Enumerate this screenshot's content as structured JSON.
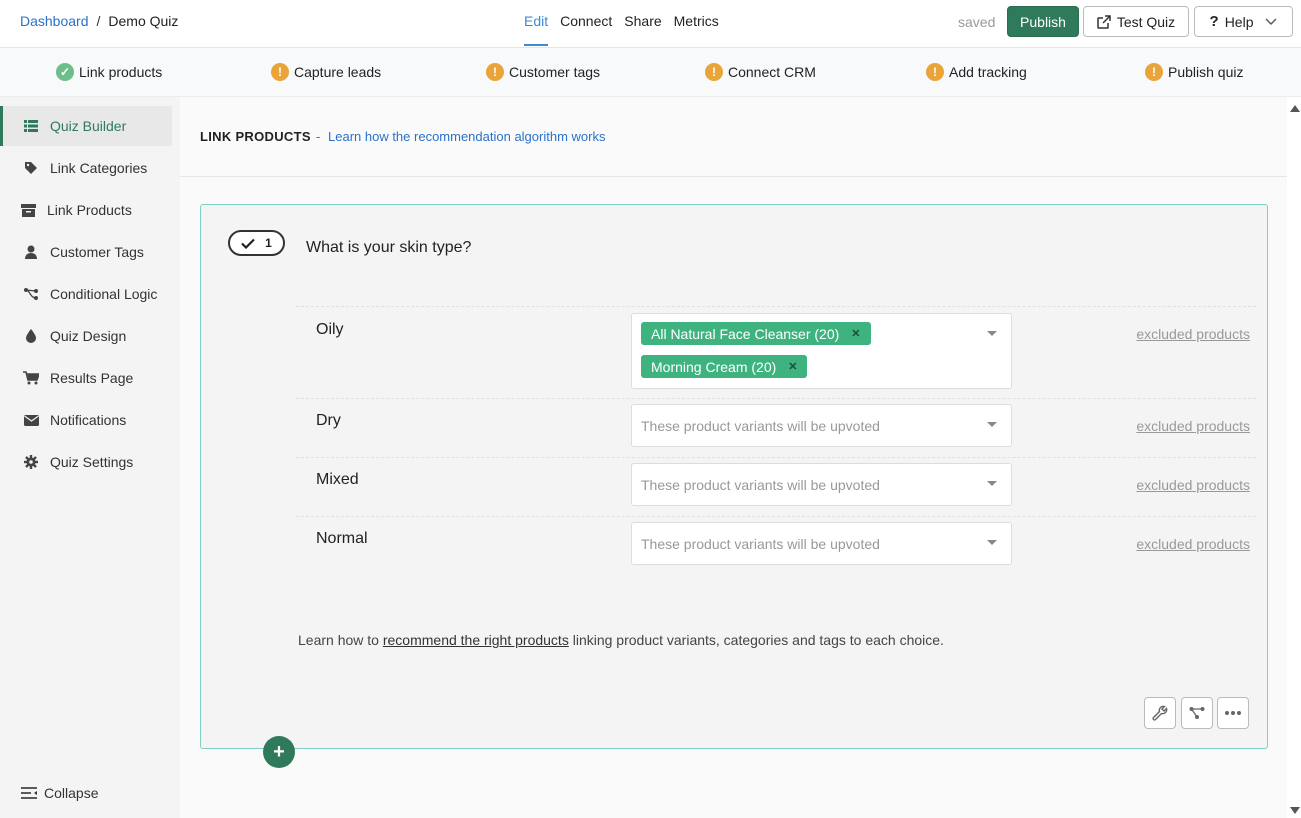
{
  "breadcrumb": {
    "dashboard": "Dashboard",
    "separator": "/",
    "current": "Demo Quiz"
  },
  "nav": {
    "tabs": [
      "Edit",
      "Connect",
      "Share",
      "Metrics"
    ],
    "active": "Edit"
  },
  "header": {
    "saved_status": "saved",
    "publish": "Publish",
    "test_quiz": "Test Quiz",
    "help": "Help"
  },
  "checklist": [
    {
      "label": "Link products",
      "status": "done",
      "icon": "check-circle-icon"
    },
    {
      "label": "Capture leads",
      "status": "warning",
      "icon": "warning-circle-icon"
    },
    {
      "label": "Customer tags",
      "status": "warning",
      "icon": "warning-circle-icon"
    },
    {
      "label": "Connect CRM",
      "status": "warning",
      "icon": "warning-circle-icon"
    },
    {
      "label": "Add tracking",
      "status": "warning",
      "icon": "warning-circle-icon"
    },
    {
      "label": "Publish quiz",
      "status": "warning",
      "icon": "warning-circle-icon"
    }
  ],
  "sidebar": {
    "items": [
      {
        "label": "Quiz Builder",
        "icon": "list-icon",
        "active": true
      },
      {
        "label": "Link Categories",
        "icon": "tag-icon"
      },
      {
        "label": "Link Products",
        "icon": "box-icon"
      },
      {
        "label": "Customer Tags",
        "icon": "user-icon"
      },
      {
        "label": "Conditional Logic",
        "icon": "branch-icon"
      },
      {
        "label": "Quiz Design",
        "icon": "drop-icon"
      },
      {
        "label": "Results Page",
        "icon": "cart-icon"
      },
      {
        "label": "Notifications",
        "icon": "envelope-icon"
      },
      {
        "label": "Quiz Settings",
        "icon": "gear-icon"
      }
    ],
    "collapse": "Collapse"
  },
  "main": {
    "section_title": "LINK PRODUCTS",
    "dash": "-",
    "section_link": "Learn how the recommendation algorithm works",
    "question": {
      "number": "1",
      "text": "What is your skin type?"
    },
    "choices": [
      {
        "label": "Oily",
        "tags": [
          "All Natural Face Cleanser (20)",
          "Morning Cream (20)"
        ],
        "placeholder": "",
        "excluded": "excluded products"
      },
      {
        "label": "Dry",
        "tags": [],
        "placeholder": "These product variants will be upvoted",
        "excluded": "excluded products"
      },
      {
        "label": "Mixed",
        "tags": [],
        "placeholder": "These product variants will be upvoted",
        "excluded": "excluded products"
      },
      {
        "label": "Normal",
        "tags": [],
        "placeholder": "These product variants will be upvoted",
        "excluded": "excluded products"
      }
    ],
    "learn": {
      "prefix": "Learn how to ",
      "link": "recommend the right products",
      "suffix": " linking product variants, categories and tags to each choice."
    }
  },
  "colors": {
    "brand": "#2f7a5b",
    "link": "#2a72c9",
    "tag": "#3fb37f",
    "warning": "#e9a43a",
    "done": "#6cbf8b"
  }
}
